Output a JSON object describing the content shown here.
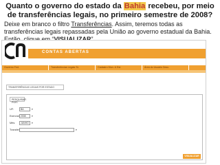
{
  "question": {
    "part1": "Quanto o governo do estado da ",
    "highlight": "Bahia",
    "part2": " recebeu, por meio de transferências legais, no primeiro semestre de 2008?"
  },
  "instruction": {
    "part1": "Deixe em branco o filtro ",
    "link": "Transferências",
    "part2": ". Assim, teremos todas as transferências legais repassadas pela União ao governo estadual da Bahia. Então, clique em “",
    "bold": "VISUALIZAR",
    "part3": "”."
  },
  "app": {
    "brand": "CONTAS ABERTAS",
    "nav": [
      "Governo Fed.",
      "Transferências Legais SL",
      "Cadastro Mun. & Est.",
      "Área do Usuário Desc."
    ],
    "breadcrumb": "TRANSFERÊNCIAS LEGAIS POR ESTADO",
    "panel_title": "PESQUISAR POR:",
    "fields": [
      {
        "label": "UF:",
        "value": "BA"
      },
      {
        "label": "Exercício:",
        "value": "2008"
      },
      {
        "label": "Mês:",
        "value": "JUNHO"
      },
      {
        "label": "Transferência:",
        "value": ""
      }
    ],
    "visualize_button": "VISUALIZAR"
  },
  "colors": {
    "accent": "#f0a030",
    "highlight_bg": "#f2c94c",
    "highlight_text": "#c0392b"
  }
}
